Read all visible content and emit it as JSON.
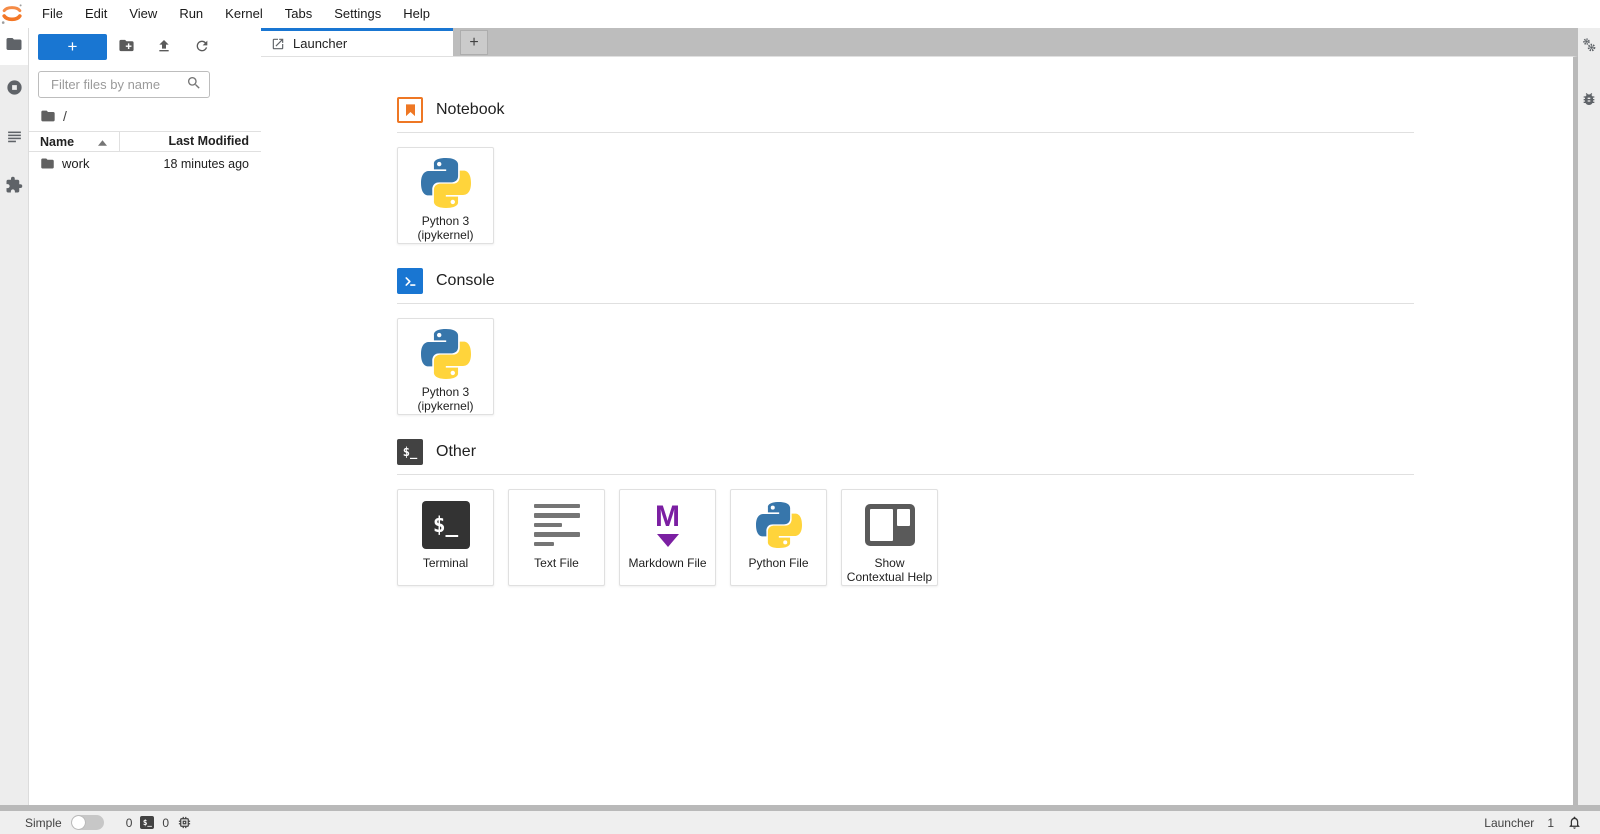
{
  "menubar": {
    "items": [
      "File",
      "Edit",
      "View",
      "Run",
      "Kernel",
      "Tabs",
      "Settings",
      "Help"
    ]
  },
  "sidebar": {
    "toolbar": {
      "new_launcher_label": "+"
    },
    "filter_placeholder": "Filter files by name",
    "breadcrumb_root": "/",
    "table": {
      "columns": [
        "Name",
        "Last Modified"
      ],
      "rows": [
        {
          "name": "work",
          "modified": "18 minutes ago"
        }
      ]
    }
  },
  "tabbar": {
    "tabs": [
      {
        "label": "Launcher",
        "active": true
      }
    ],
    "add_label": "+"
  },
  "launcher": {
    "sections": [
      {
        "title": "Notebook",
        "cards": [
          {
            "label": "Python 3",
            "label2": "(ipykernel)"
          }
        ]
      },
      {
        "title": "Console",
        "cards": [
          {
            "label": "Python 3",
            "label2": "(ipykernel)"
          }
        ]
      },
      {
        "title": "Other",
        "cards": [
          {
            "label": "Terminal",
            "label2": ""
          },
          {
            "label": "Text File",
            "label2": ""
          },
          {
            "label": "Markdown File",
            "label2": ""
          },
          {
            "label": "Python File",
            "label2": ""
          },
          {
            "label": "Show",
            "label2": "Contextual Help"
          }
        ]
      }
    ]
  },
  "statusbar": {
    "mode_label": "Simple",
    "terminals_count": "0",
    "kernels_count": "0",
    "current_activity": "Launcher",
    "notifications_count": "1"
  },
  "glyphs": {
    "shell_prompt": "$_",
    "markdown_m": "M"
  },
  "colors": {
    "accent_blue": "#1976d2",
    "jupyter_orange": "#f37726",
    "notebook_orange": "#ee7724",
    "markdown_purple": "#7b1fa2",
    "python_blue": "#3776ab",
    "python_yellow": "#ffd43b",
    "terminal_dark": "#333333",
    "tab_bar_gray": "#bdbdbd",
    "dock_border_gray": "#b9b9b9"
  }
}
